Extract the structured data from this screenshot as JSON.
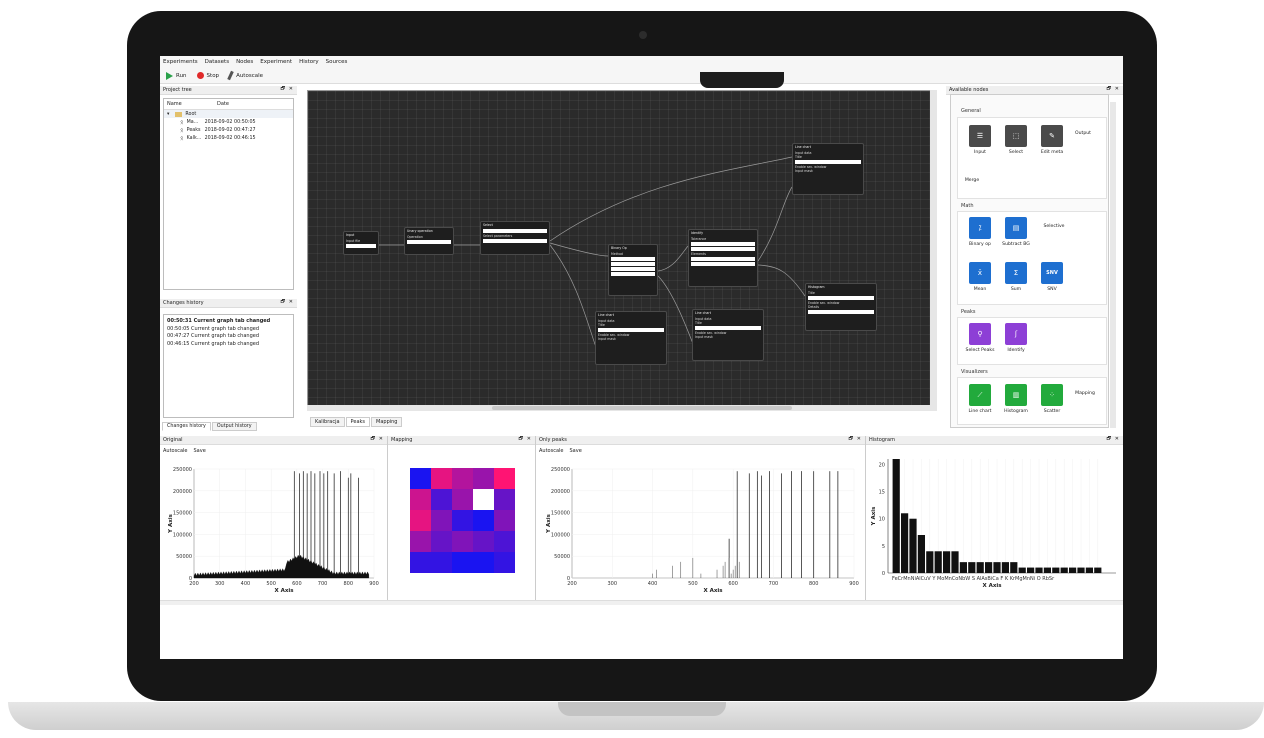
{
  "menu": [
    "Experiments",
    "Datasets",
    "Nodes",
    "Experiment",
    "History",
    "Sources"
  ],
  "toolbar": {
    "run": "Run",
    "stop": "Stop",
    "autoscale": "Autoscale"
  },
  "project_tree": {
    "title": "Project tree",
    "col_name": "Name",
    "col_date": "Date",
    "root": "Root",
    "rows": [
      {
        "name": "Ma...",
        "date": "2018-09-02 00:50:05"
      },
      {
        "name": "Peaks",
        "date": "2018-09-02 00:47:27"
      },
      {
        "name": "Kalk...",
        "date": "2018-09-02 00:46:15"
      }
    ]
  },
  "changes_history": {
    "title": "Changes history",
    "lines": [
      "00:50:31 Current graph tab changed",
      "00:50:05 Current graph tab changed",
      "00:47:27 Current graph tab changed",
      "00:46:15 Current graph tab changed"
    ],
    "tabs": [
      "Changes history",
      "Output history"
    ]
  },
  "graph_tabs": [
    "Kalibracja",
    "Peaks",
    "Mapping"
  ],
  "available_nodes": {
    "title": "Available nodes",
    "sections": [
      {
        "name": "General",
        "items": [
          "Input",
          "Select",
          "Edit meta",
          "Output",
          "Merge"
        ]
      },
      {
        "name": "Math",
        "items": [
          "Binary op",
          "Subtract BG",
          "Selective",
          "Mean",
          "Sum",
          "SNV"
        ]
      },
      {
        "name": "Peaks",
        "items": [
          "Select Peaks",
          "Identify"
        ]
      },
      {
        "name": "Visualizers",
        "items": [
          "Line chart",
          "Histogram",
          "Scatter",
          "Mapping"
        ]
      }
    ],
    "snv_glyph": "SNV",
    "sum_glyph": "Σ"
  },
  "panels": {
    "original": {
      "title": "Original",
      "actions": [
        "Autoscale",
        "Save"
      ]
    },
    "mapping": {
      "title": "Mapping"
    },
    "only_peaks": {
      "title": "Only peaks",
      "actions": [
        "Autoscale",
        "Save"
      ]
    },
    "histogram": {
      "title": "Histogram"
    }
  },
  "panel_ctrl": "🗗 ✕",
  "chart_data": [
    {
      "type": "line",
      "title": "Original",
      "xlabel": "X Axis",
      "ylabel": "Y Axis",
      "xlim": [
        200,
        900
      ],
      "ylim": [
        0,
        250000
      ],
      "x_ticks": [
        200,
        300,
        400,
        500,
        600,
        700,
        800,
        900
      ],
      "y_ticks": [
        0,
        50000,
        100000,
        150000,
        200000,
        250000
      ],
      "y_tick_labels": [
        "0",
        "50000",
        "100000",
        "150000",
        "200000",
        "250000"
      ],
      "peaks_x": [
        590,
        610,
        625,
        640,
        655,
        670,
        690,
        705,
        720,
        745,
        770,
        800,
        810,
        840
      ],
      "peaks_y": [
        245000,
        240000,
        245000,
        240000,
        245000,
        240000,
        245000,
        240000,
        245000,
        240000,
        245000,
        230000,
        240000,
        230000
      ]
    },
    {
      "type": "heatmap",
      "title": "Mapping",
      "rows": 5,
      "cols": 5,
      "values": [
        [
          0.1,
          0.9,
          0.7,
          0.6,
          1.0
        ],
        [
          0.8,
          0.3,
          0.6,
          -1,
          0.4
        ],
        [
          0.9,
          0.5,
          0.2,
          0.1,
          0.5
        ],
        [
          0.6,
          0.4,
          0.5,
          0.4,
          0.3
        ],
        [
          0.2,
          0.2,
          0.1,
          0.1,
          0.2
        ]
      ]
    },
    {
      "type": "line",
      "title": "Only peaks",
      "xlabel": "X Axis",
      "ylabel": "Y Axis",
      "xlim": [
        200,
        900
      ],
      "ylim": [
        0,
        250000
      ],
      "x_ticks": [
        200,
        300,
        400,
        500,
        600,
        700,
        800,
        900
      ],
      "y_ticks": [
        0,
        50000,
        100000,
        150000,
        200000,
        250000
      ],
      "y_tick_labels": [
        "0",
        "50000",
        "100000",
        "150000",
        "200000",
        "250000"
      ],
      "peaks_x": [
        590,
        610,
        640,
        660,
        670,
        690,
        720,
        745,
        770,
        800,
        840,
        860
      ],
      "peaks_y": [
        90000,
        245000,
        240000,
        245000,
        235000,
        245000,
        240000,
        245000,
        245000,
        245000,
        245000,
        245000
      ]
    },
    {
      "type": "bar",
      "title": "Histogram",
      "xlabel": "X Axis",
      "ylabel": "Y Axis",
      "ylim": [
        0,
        21
      ],
      "y_ticks": [
        0,
        5,
        10,
        15,
        20
      ],
      "values": [
        21,
        11,
        10,
        7,
        4,
        4,
        4,
        4,
        2,
        2,
        2,
        2,
        2,
        2,
        2,
        1,
        1,
        1,
        1,
        1,
        1,
        1,
        1,
        1,
        1
      ],
      "x_tick_text": "FeCrMnNiAlCuV Y MoMnCoNbW S AlAsBiCa F K KrMgMnNi O RbSr"
    }
  ]
}
